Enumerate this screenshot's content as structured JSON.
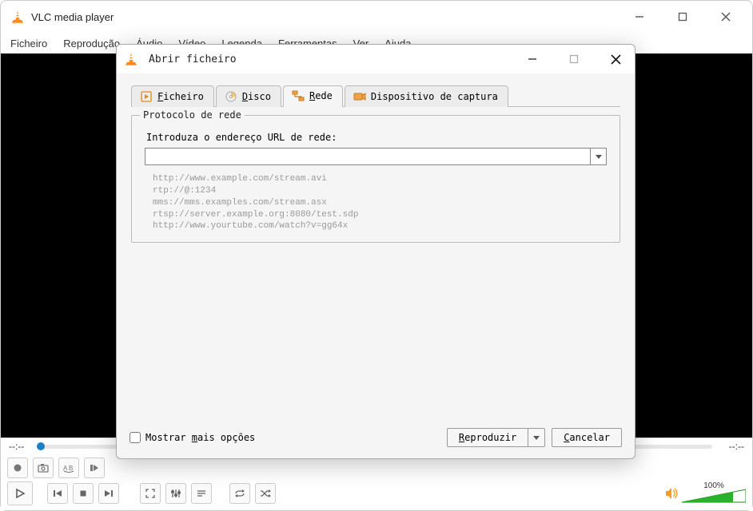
{
  "main": {
    "title": "VLC media player",
    "menu": [
      "Ficheiro",
      "Reprodução",
      "Áudio",
      "Vídeo",
      "Legenda",
      "Ferramentas",
      "Ver",
      "Ajuda"
    ],
    "time_left": "--:--",
    "time_right": "--:--",
    "volume_pct": "100%"
  },
  "dialog": {
    "title": "Abrir ficheiro",
    "tabs": {
      "file": "Ficheiro",
      "file_ul": "F",
      "disc": "isco",
      "disc_ul": "D",
      "net": "ede",
      "net_ul": "R",
      "capture": "Dispositivo de captura"
    },
    "group_title": "Protocolo de rede",
    "url_label": "Introduza o endereço URL de rede:",
    "url_value": "",
    "examples": "http://www.example.com/stream.avi\nrtp://@:1234\nmms://mms.examples.com/stream.asx\nrtsp://server.example.org:8080/test.sdp\nhttp://www.yourtube.com/watch?v=gg64x",
    "show_more": "Mostrar ",
    "show_more_ul": "m",
    "show_more_rest": "ais opções",
    "play_btn": "eproduzir",
    "play_btn_ul": "R",
    "cancel_btn": "ancelar",
    "cancel_btn_ul": "C"
  }
}
